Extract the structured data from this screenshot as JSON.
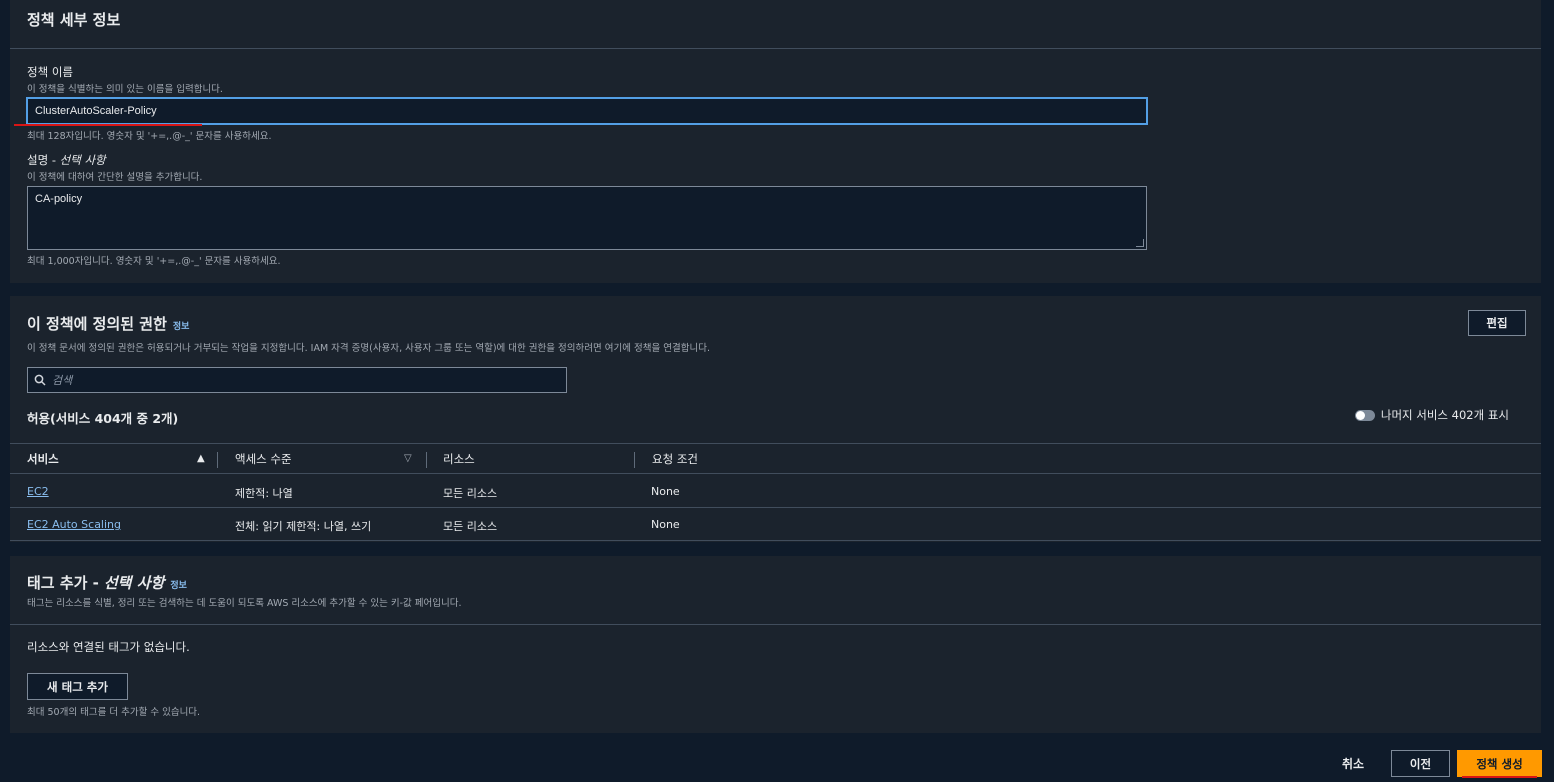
{
  "policy_details": {
    "title": "정책 세부 정보",
    "name_label": "정책 이름",
    "name_desc": "이 정책을 식별하는 의미 있는 이름을 입력합니다.",
    "name_value": "ClusterAutoScaler-Policy",
    "name_hint": "최대 128자입니다. 영숫자 및 '+=,.@-_' 문자를 사용하세요.",
    "desc_label": "설명 -",
    "desc_optional": "선택 사항",
    "desc_desc": "이 정책에 대하여 간단한 설명을 추가합니다.",
    "desc_value": "CA-policy",
    "desc_hint": "최대 1,000자입니다. 영숫자 및 '+=,.@-_' 문자를 사용하세요."
  },
  "permissions": {
    "title": "이 정책에 정의된 권한",
    "info": "정보",
    "edit_button": "편집",
    "description": "이 정책 문서에 정의된 권한은 허용되거나 거부되는 작업을 지정합니다. IAM 자격 증명(사용자, 사용자 그룹 또는 역할)에 대한 권한을 정의하려면 여기에 정책을 연결합니다.",
    "search_placeholder": "검색",
    "allow_summary": "허용(서비스 404개 중 2개)",
    "toggle_label": "나머지 서비스 402개 표시",
    "columns": [
      "서비스",
      "액세스 수준",
      "리소스",
      "요청 조건"
    ],
    "rows": [
      {
        "service": "EC2",
        "access": "제한적: 나열",
        "resource": "모든 리소스",
        "condition": "None"
      },
      {
        "service": "EC2 Auto Scaling",
        "access": "전체: 읽기 제한적: 나열, 쓰기",
        "resource": "모든 리소스",
        "condition": "None"
      }
    ]
  },
  "tags": {
    "title": "태그 추가 -",
    "title_optional": "선택 사항",
    "info": "정보",
    "description": "태그는 리소스를 식별, 정리 또는 검색하는 데 도움이 되도록 AWS 리소스에 추가할 수 있는 키-값 페어입니다.",
    "empty_text": "리소스와 연결된 태그가 없습니다.",
    "add_button": "새 태그 추가",
    "limit_hint": "최대 50개의 태그를 더 추가할 수 있습니다."
  },
  "footer": {
    "cancel": "취소",
    "previous": "이전",
    "create": "정책 생성"
  },
  "colors": {
    "primary": "#ff9900",
    "link": "#89bdee",
    "focus": "#539fe5",
    "annotation": "#d91515"
  }
}
